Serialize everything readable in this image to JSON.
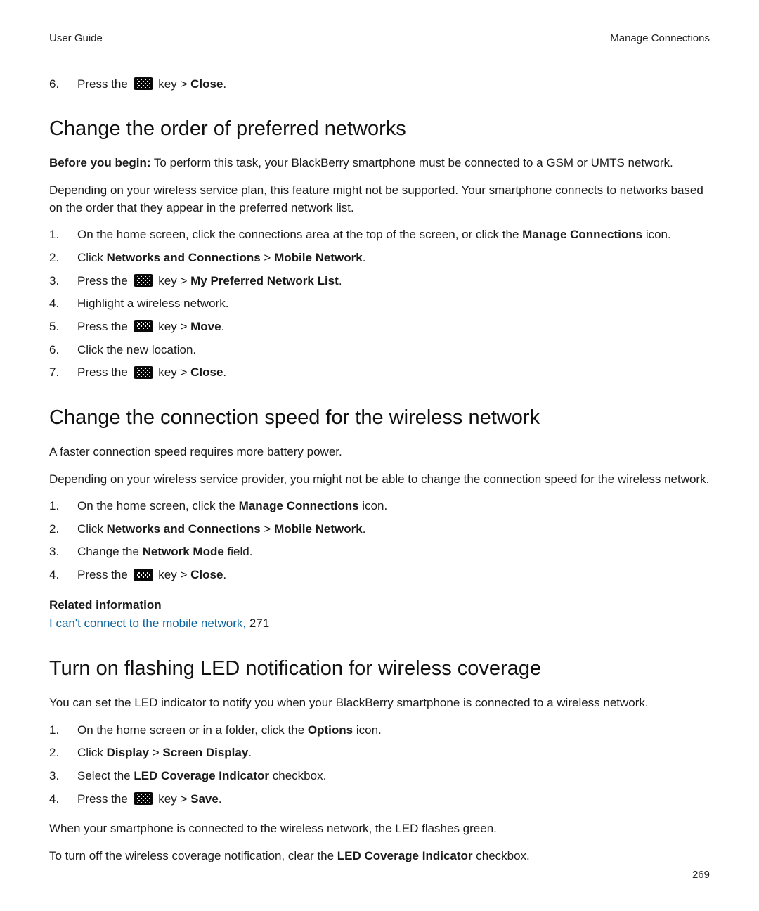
{
  "header": {
    "left": "User Guide",
    "right": "Manage Connections"
  },
  "intro_step": {
    "press_the": "Press the",
    "key_gt": " key > ",
    "action": "Close",
    "period": "."
  },
  "section1": {
    "title": "Change the order of preferred networks",
    "before_label": "Before you begin:",
    "before_text": " To perform this task, your BlackBerry smartphone must be connected to a GSM or UMTS network.",
    "para": "Depending on your wireless service plan, this feature might not be supported. Your smartphone connects to networks based on the order that they appear in the preferred network list.",
    "steps": {
      "s1_a": "On the home screen, click the connections area at the top of the screen, or click the ",
      "s1_b": "Manage Connections",
      "s1_c": " icon.",
      "s2_a": "Click ",
      "s2_b": "Networks and Connections",
      "s2_gt": " > ",
      "s2_c": "Mobile Network",
      "s2_d": ".",
      "s3_a": "Press the",
      "s3_key": " key > ",
      "s3_b": "My Preferred Network List",
      "s3_c": ".",
      "s4": "Highlight a wireless network.",
      "s5_a": "Press the",
      "s5_key": " key > ",
      "s5_b": "Move",
      "s5_c": ".",
      "s6": "Click the new location.",
      "s7_a": "Press the",
      "s7_key": " key > ",
      "s7_b": "Close",
      "s7_c": "."
    }
  },
  "section2": {
    "title": "Change the connection speed for the wireless network",
    "para1": "A faster connection speed requires more battery power.",
    "para2": "Depending on your wireless service provider, you might not be able to change the connection speed for the wireless network.",
    "steps": {
      "s1_a": "On the home screen, click the ",
      "s1_b": "Manage Connections",
      "s1_c": " icon.",
      "s2_a": "Click ",
      "s2_b": "Networks and Connections",
      "s2_gt": " > ",
      "s2_c": "Mobile Network",
      "s2_d": ".",
      "s3_a": "Change the ",
      "s3_b": "Network Mode",
      "s3_c": " field.",
      "s4_a": "Press the",
      "s4_key": " key > ",
      "s4_b": "Close",
      "s4_c": "."
    },
    "related_title": "Related information",
    "related_link": "I can't connect to the mobile network,",
    "related_page": " 271"
  },
  "section3": {
    "title": "Turn on flashing LED notification for wireless coverage",
    "para1": "You can set the LED indicator to notify you when your BlackBerry smartphone is connected to a wireless network.",
    "steps": {
      "s1_a": "On the home screen or in a folder, click the ",
      "s1_b": "Options",
      "s1_c": " icon.",
      "s2_a": "Click ",
      "s2_b": "Display",
      "s2_gt": " > ",
      "s2_c": "Screen Display",
      "s2_d": ".",
      "s3_a": "Select the ",
      "s3_b": "LED Coverage Indicator",
      "s3_c": " checkbox.",
      "s4_a": "Press the",
      "s4_key": " key > ",
      "s4_b": "Save",
      "s4_c": "."
    },
    "para2": "When your smartphone is connected to the wireless network, the LED flashes green.",
    "para3_a": "To turn off the wireless coverage notification, clear the ",
    "para3_b": "LED Coverage Indicator",
    "para3_c": " checkbox."
  },
  "page_number": "269"
}
